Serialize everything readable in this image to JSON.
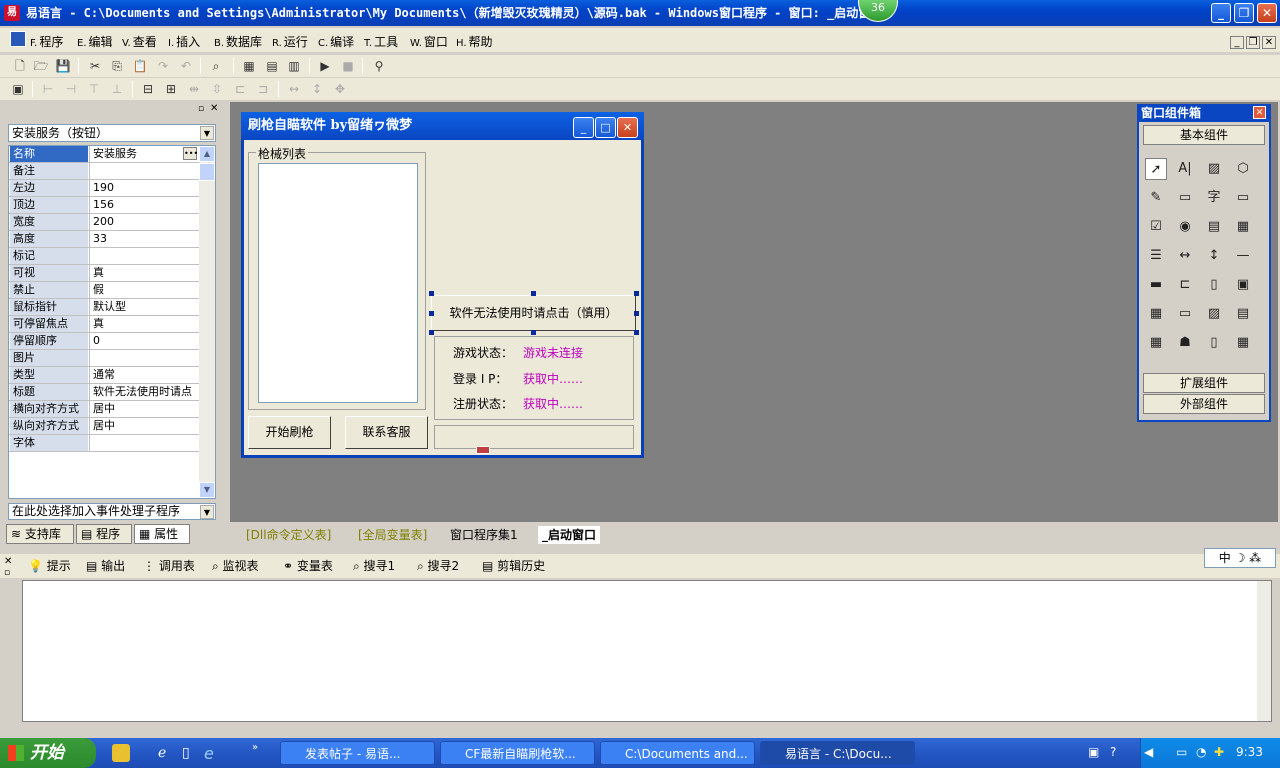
{
  "window": {
    "title": "易语言 - C:\\Documents and Settings\\Administrator\\My Documents\\（新增毁灭玫瑰精灵）\\源码.bak - Windows窗口程序 - 窗口: _启动窗口]",
    "badge": "36"
  },
  "menu": [
    {
      "key": "F.",
      "label": "程序"
    },
    {
      "key": "E.",
      "label": "编辑"
    },
    {
      "key": "V.",
      "label": "查看"
    },
    {
      "key": "I.",
      "label": "插入"
    },
    {
      "key": "B.",
      "label": "数据库"
    },
    {
      "key": "R.",
      "label": "运行"
    },
    {
      "key": "C.",
      "label": "编译"
    },
    {
      "key": "T.",
      "label": "工具"
    },
    {
      "key": "W.",
      "label": "窗口"
    },
    {
      "key": "H.",
      "label": "帮助"
    }
  ],
  "properties": {
    "object": "安装服务（按钮）",
    "rows": [
      {
        "name": "名称",
        "value": "安装服务"
      },
      {
        "name": "备注",
        "value": ""
      },
      {
        "name": "左边",
        "value": "190"
      },
      {
        "name": "顶边",
        "value": "156"
      },
      {
        "name": "宽度",
        "value": "200"
      },
      {
        "name": "高度",
        "value": "33"
      },
      {
        "name": "标记",
        "value": ""
      },
      {
        "name": "可视",
        "value": "真"
      },
      {
        "name": "禁止",
        "value": "假"
      },
      {
        "name": "鼠标指针",
        "value": "默认型"
      },
      {
        "name": "可停留焦点",
        "value": "真"
      },
      {
        "name": "  停留顺序",
        "value": "0"
      },
      {
        "name": "图片",
        "value": ""
      },
      {
        "name": "类型",
        "value": "通常"
      },
      {
        "name": "标题",
        "value": "软件无法使用时请点"
      },
      {
        "name": "横向对齐方式",
        "value": "居中"
      },
      {
        "name": "纵向对齐方式",
        "value": "居中"
      },
      {
        "name": "字体",
        "value": ""
      }
    ],
    "event_placeholder": "在此处选择加入事件处理子程序"
  },
  "left_tabs": [
    "支持库",
    "程序",
    "属性"
  ],
  "form": {
    "title": "刷枪自瞄软件   by留绪ヮ微梦",
    "group_label": "枪械列表",
    "btn_start": "开始刷枪",
    "btn_contact": "联系客服",
    "btn_install": "软件无法使用时请点击（慎用）",
    "status": [
      {
        "label": "游戏状态：",
        "value": "游戏未连接"
      },
      {
        "label": "登录 I P：",
        "value": "获取中……"
      },
      {
        "label": "注册状态：",
        "value": "获取中……"
      }
    ]
  },
  "toolbox": {
    "title": "窗口组件箱",
    "basic": "基本组件",
    "extended": "扩展组件",
    "external": "外部组件",
    "tools": [
      "pointer-icon",
      "label-icon",
      "image-icon",
      "shape-icon",
      "edit-icon",
      "groupbox-icon",
      "text-icon",
      "rect-icon",
      "checkbox-icon",
      "radio-icon",
      "combobox-icon",
      "listbox-icon",
      "tree-icon",
      "hscroll-icon",
      "vscroll-icon",
      "divider-icon",
      "progress-icon",
      "tab-icon",
      "file-icon",
      "picture-icon",
      "grid-icon",
      "button-icon",
      "dir-icon",
      "document-icon",
      "table-icon",
      "network-icon",
      "drive-icon",
      "calendar-icon"
    ]
  },
  "design_tabs": [
    "[Dll命令定义表]",
    "[全局变量表]",
    "窗口程序集1",
    "_启动窗口"
  ],
  "output_tabs": [
    "提示",
    "输出",
    "调用表",
    "监视表",
    "变量表",
    "搜寻1",
    "搜寻2",
    "剪辑历史"
  ],
  "ime": "中 ☽ ⁂",
  "taskbar": {
    "start": "开始",
    "tasks": [
      "发表帖子 - 易语...",
      "CF最新自瞄刷枪软...",
      "C:\\Documents and...",
      "易语言 - C:\\Docu..."
    ],
    "clock": "9:33"
  },
  "colors": {
    "accent": "#0a46c2",
    "status_value": "#c000c0",
    "selection": "#316ac5"
  }
}
